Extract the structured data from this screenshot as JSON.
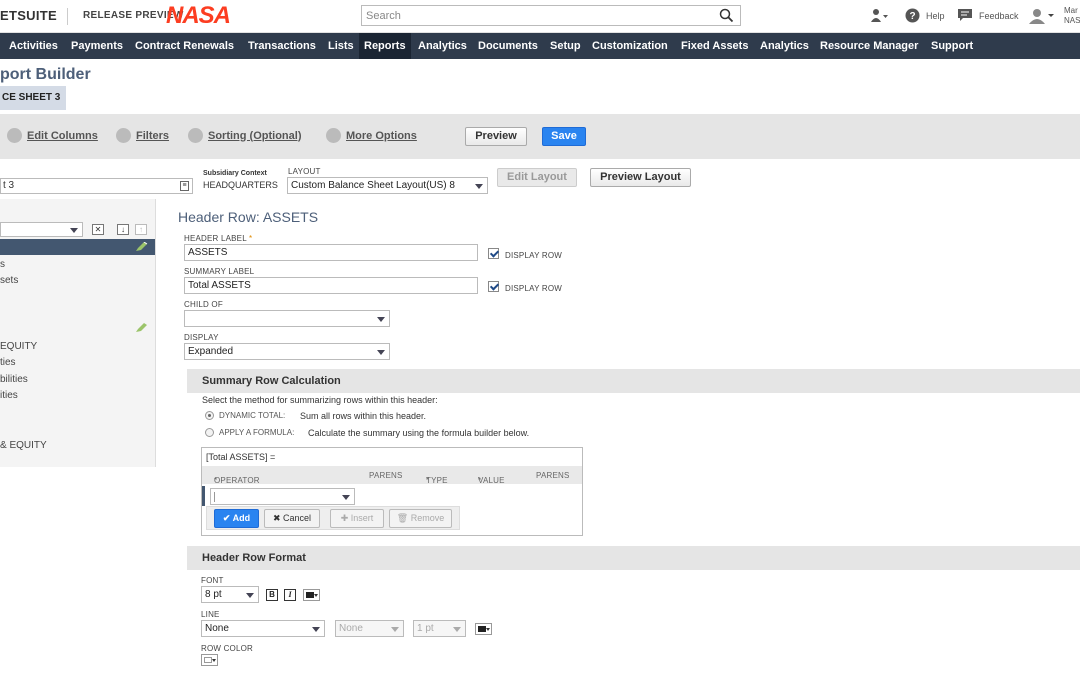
{
  "header": {
    "logo": "ETSUITE",
    "release": "RELEASE PREVIEW",
    "brand": "NASA",
    "search_placeholder": "Search",
    "help": "Help",
    "feedback": "Feedback",
    "user_line1": "Mar",
    "user_line2": "NAS"
  },
  "nav": [
    "Activities",
    "Payments",
    "Contract Renewals",
    "Transactions",
    "Lists",
    "Reports",
    "Analytics",
    "Documents",
    "Setup",
    "Customization",
    "Fixed Assets",
    "Analytics",
    "Resource Manager",
    "Support"
  ],
  "nav_active": "Reports",
  "page": {
    "title": "port Builder",
    "report_name": "CE SHEET 3"
  },
  "toolbar": {
    "edit_columns": "Edit Columns",
    "filters": "Filters",
    "sorting": "Sorting (Optional)",
    "more_options": "More Options",
    "preview": "Preview",
    "save": "Save"
  },
  "layout_row": {
    "name_value": "t 3",
    "subsidiary_label": "Subsidiary Context",
    "subsidiary_value": "HEADQUARTERS",
    "layout_label": "LAYOUT",
    "layout_value": "Custom Balance Sheet Layout(US) 8",
    "edit_layout": "Edit Layout",
    "preview_layout": "Preview Layout"
  },
  "left_panel": {
    "items": [
      "s",
      "sets",
      "EQUITY",
      "ties",
      "bilities",
      "ities",
      "& EQUITY"
    ]
  },
  "form": {
    "section_title": "Header Row: ASSETS",
    "header_label_lbl": "HEADER LABEL",
    "header_label_req": "*",
    "header_label_value": "ASSETS",
    "display_row_1": "DISPLAY ROW",
    "summary_label_lbl": "SUMMARY LABEL",
    "summary_label_value": "Total ASSETS",
    "display_row_2": "DISPLAY ROW",
    "child_of_lbl": "CHILD OF",
    "child_of_value": "",
    "display_lbl": "DISPLAY",
    "display_value": "Expanded"
  },
  "summary_calc": {
    "title": "Summary Row Calculation",
    "instruction": "Select the method for summarizing rows within this header:",
    "opt1_label": "DYNAMIC TOTAL:",
    "opt1_desc": "Sum all rows within this header.",
    "opt2_label": "APPLY A FORMULA:",
    "opt2_desc": "Calculate the summary using the formula builder below.",
    "formula_text": "[Total ASSETS] =",
    "columns": {
      "operator": "OPERATOR",
      "parens1": "PARENS",
      "type": "TYPE",
      "value": "VALUE",
      "parens2": "PARENS"
    },
    "req_mark": "*",
    "buttons": {
      "add": "Add",
      "cancel": "Cancel",
      "insert": "Insert",
      "remove": "Remove"
    }
  },
  "format": {
    "title": "Header Row Format",
    "font_lbl": "FONT",
    "font_size": "8 pt",
    "bold": "B",
    "italic": "I",
    "line_lbl": "LINE",
    "line_value": "None",
    "line_style": "None",
    "line_width": "1 pt",
    "row_color_lbl": "ROW COLOR"
  }
}
